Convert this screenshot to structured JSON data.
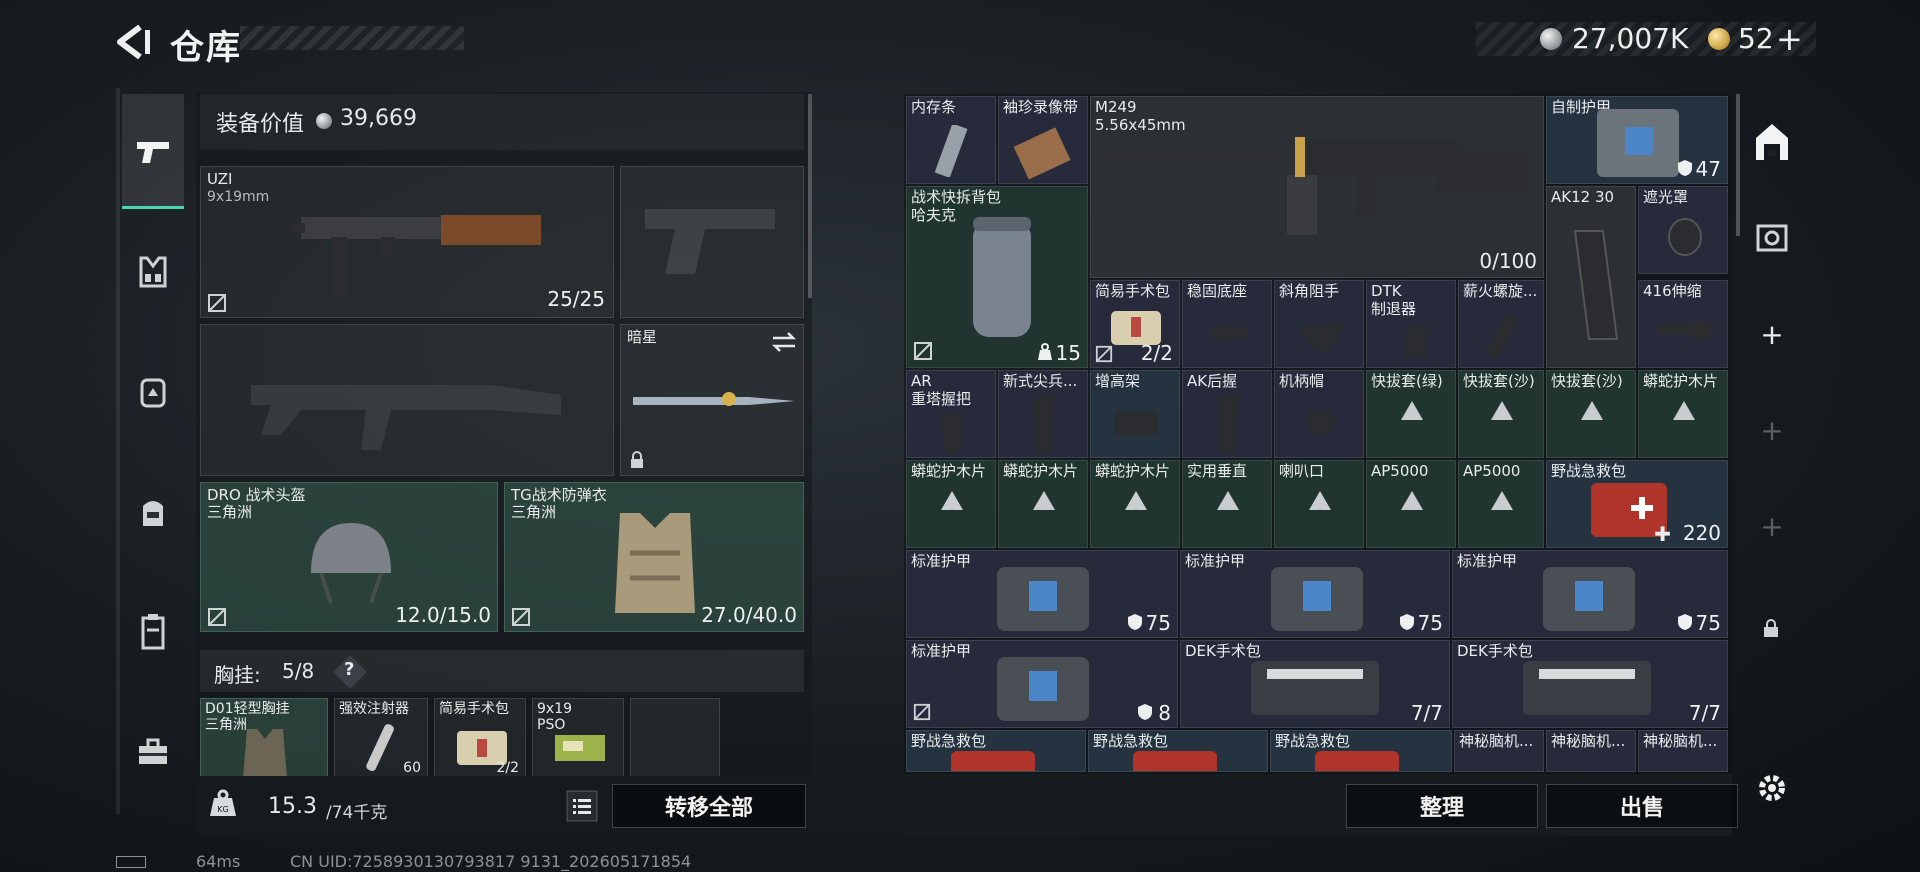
{
  "header": {
    "title": "仓库"
  },
  "currency": {
    "silver": "27,007K",
    "gold": "52",
    "gold_add": "+"
  },
  "nav": {
    "items": [
      {
        "name": "weapons"
      },
      {
        "name": "vest"
      },
      {
        "name": "backpack-armor"
      },
      {
        "name": "backpack"
      },
      {
        "name": "container"
      },
      {
        "name": "toolbox"
      }
    ]
  },
  "loadout": {
    "equip_value_label": "装备价值",
    "equip_value": "39,669",
    "primary": {
      "name": "UZI",
      "caliber": "9x19mm",
      "ammo": "25/25"
    },
    "melee": {
      "name": "暗星"
    },
    "helmet": {
      "name": "DRO 战术头盔",
      "brand": "三角洲",
      "durability": "12.0/15.0"
    },
    "armor": {
      "name": "TG战术防弹衣",
      "brand": "三角洲",
      "durability": "27.0/40.0"
    },
    "chest_rig": {
      "label": "胸挂:",
      "count": "5/8",
      "help": "?",
      "items": [
        {
          "name": "D01轻型胸挂",
          "brand": "三角洲"
        },
        {
          "name": "强效注射器",
          "qty": "60"
        },
        {
          "name": "简易手术包",
          "qty": "2/2"
        },
        {
          "name": "9x19",
          "sub": "PSO"
        },
        {
          "name": ""
        }
      ]
    },
    "weight_current": "15.3",
    "weight_max": "/74千克",
    "transfer_all": "转移全部"
  },
  "stash": {
    "items": {
      "memory": "内存条",
      "recorder": "袖珍录像带",
      "m249": "M249",
      "m249_cal": "5.56x45mm",
      "m249_ammo": "0/100",
      "homemade_armor": "自制护甲",
      "homemade_armor_val": "47",
      "backpack": "战术快拆背包",
      "backpack_brand": "哈夫克",
      "backpack_val": "15",
      "ak12": "AK12 30",
      "light_shield": "遮光罩",
      "surgery_kit": "简易手术包",
      "surgery_kit_val": "2/2",
      "stable_base": "稳固底座",
      "angled_grip": "斜角阻手",
      "dtk": "DTK",
      "dtk_sub": "制退器",
      "spiral": "薪火螺旋...",
      "stock_416": "416伸缩",
      "ar_grip": "AR",
      "ar_grip_sub": "重塔握把",
      "new_tip": "新式尖兵...",
      "riser": "增高架",
      "ak_grip": "AK后握",
      "handle_cap": "机柄帽",
      "quick_green": "快拔套(绿)",
      "quick_sand1": "快拔套(沙)",
      "quick_sand2": "快拔套(沙)",
      "python_wood1": "蟒蛇护木片",
      "python_wood2": "蟒蛇护木片",
      "python_wood3": "蟒蛇护木片",
      "python_wood4": "蟒蛇护木片",
      "practical_vertical": "实用垂直",
      "horn": "喇叭口",
      "ap5000_1": "AP5000",
      "ap5000_2": "AP5000",
      "field_kit_big": "野战急救包",
      "field_kit_big_val": "220",
      "std_armor_1": "标准护甲",
      "std_armor_1_val": "75",
      "std_armor_2": "标准护甲",
      "std_armor_2_val": "75",
      "std_armor_3": "标准护甲",
      "std_armor_3_val": "75",
      "std_armor_4": "标准护甲",
      "std_armor_4_val": "8",
      "dek_1": "DEK手术包",
      "dek_1_val": "7/7",
      "dek_2": "DEK手术包",
      "dek_2_val": "7/7",
      "field_kit_1": "野战急救包",
      "field_kit_2": "野战急救包",
      "field_kit_3": "野战急救包",
      "mystery_1": "神秘脑机...",
      "mystery_2": "神秘脑机...",
      "mystery_3": "神秘脑机..."
    },
    "sort_button": "整理",
    "sell_button": "出售"
  },
  "footer": {
    "ping": "64ms",
    "uid": "CN UID:7258930130793817 9131_202605171854"
  },
  "colors": {
    "accent": "#45d7b4",
    "purple_cell": "#262a3a",
    "blue_cell": "#253240",
    "green_cell": "#203530"
  }
}
